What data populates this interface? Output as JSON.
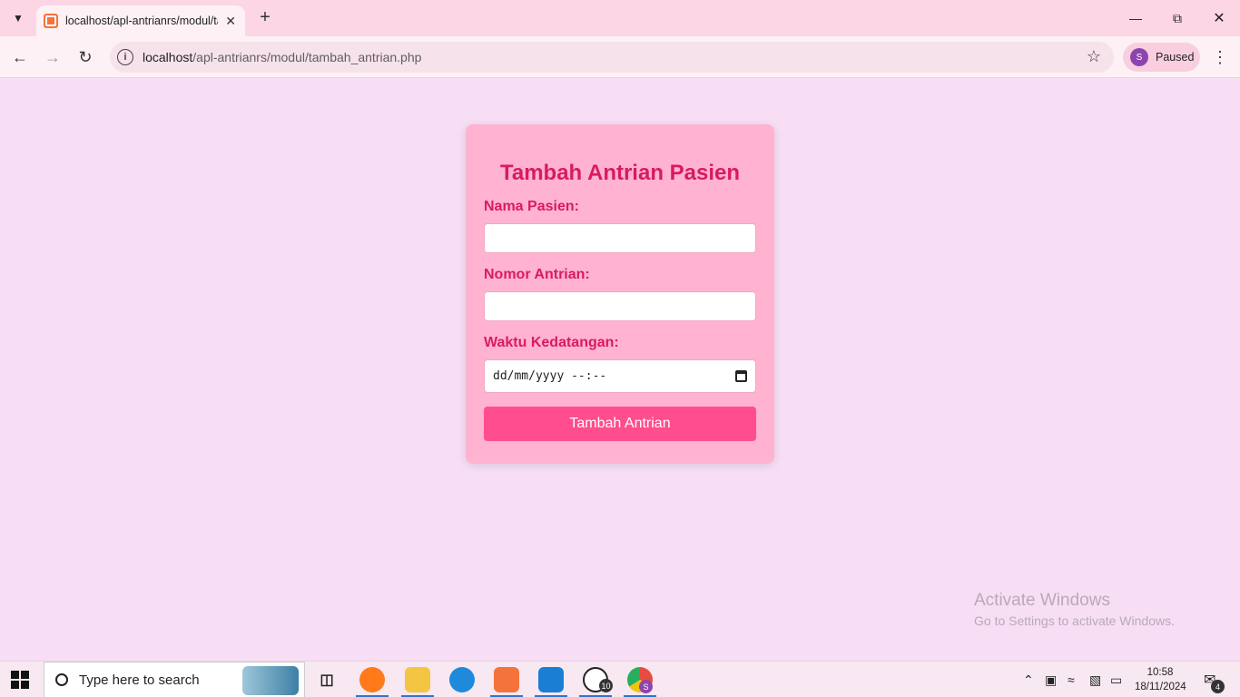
{
  "browser": {
    "tab_title": "localhost/apl-antrianrs/modul/tambah_antrian.php",
    "url_host": "localhost",
    "url_path": "/apl-antrianrs/modul/tambah_antrian.php",
    "profile_initial": "S",
    "profile_status": "Paused"
  },
  "form": {
    "title": "Tambah Antrian Pasien",
    "nama_label": "Nama Pasien:",
    "nama_value": "",
    "nomor_label": "Nomor Antrian:",
    "nomor_value": "",
    "waktu_label": "Waktu Kedatangan:",
    "waktu_placeholder": "dd/mm/yyyy --:--",
    "submit_label": "Tambah Antrian"
  },
  "watermark": {
    "title": "Activate Windows",
    "subtitle": "Go to Settings to activate Windows."
  },
  "taskbar": {
    "search_placeholder": "Type here to search",
    "whatsapp_badge": "10",
    "chrome_badge": "S",
    "time": "10:58",
    "date": "18/11/2024",
    "notification_count": "4",
    "icons": [
      "start-icon",
      "task-view-icon",
      "firefox-icon",
      "file-explorer-icon",
      "edge-icon",
      "xampp-icon",
      "vscode-icon",
      "whatsapp-icon",
      "chrome-icon"
    ]
  },
  "colors": {
    "page_bg": "#f7def5",
    "card_bg": "#ffb3d0",
    "heading": "#d81b60",
    "button": "#ff4d8d"
  }
}
